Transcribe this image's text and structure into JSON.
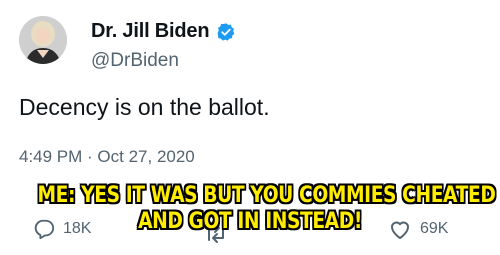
{
  "author": {
    "name": "Dr. Jill Biden",
    "handle": "@DrBiden",
    "verified": true
  },
  "tweet": {
    "text": "Decency is on the ballot.",
    "timestamp": "4:49 PM · Oct 27, 2020"
  },
  "actions": {
    "replies": "18K",
    "likes": "69K"
  },
  "meme_caption": {
    "line1": "ME: YES IT WAS BUT YOU COMMIES CHEATED",
    "line2": "AND GOT IN INSTEAD!"
  },
  "colors": {
    "verified_badge": "#1d9bf0",
    "secondary_text": "#536471",
    "caption_fill": "#ffec00",
    "caption_outline": "#000000"
  },
  "icons": {
    "avatar": "avatar",
    "verified": "verified-badge-icon",
    "reply": "reply-icon",
    "retweet": "retweet-icon",
    "like": "heart-icon"
  }
}
